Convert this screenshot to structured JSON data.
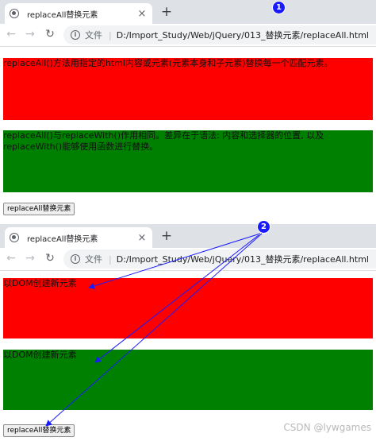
{
  "screens": [
    {
      "badge": "1",
      "tab_title": "replaceAll替换元素",
      "address_label": "文件",
      "url": "D:/Import_Study/Web/jQuery/013_替换元素/replaceAll.html",
      "red_text": "replaceAll()方法用指定的html内容或元素(元素本身和子元素)替换每一个匹配元素。",
      "green_text": "replaceAll()与replaceWith()作用相同。差异在于语法: 内容和选择器的位置, 以及replaceWith()能够使用函数进行替换。",
      "button_label": "replaceAll替换元素"
    },
    {
      "badge": "2",
      "tab_title": "replaceAll替换元素",
      "address_label": "文件",
      "url": "D:/Import_Study/Web/jQuery/013_替换元素/replaceAll.html",
      "red_text": "以DOM创建新元素",
      "green_text": "以DOM创建新元素",
      "button_label": "replaceAll替换元素"
    }
  ],
  "icons": {
    "close": "×",
    "new_tab": "+",
    "back": "←",
    "forward": "→",
    "reload": "↻",
    "info": "i"
  },
  "colors": {
    "red_box": "#ff0000",
    "green_box": "#008000",
    "annotation": "#1a1aff"
  },
  "watermark": "CSDN @lywgames"
}
